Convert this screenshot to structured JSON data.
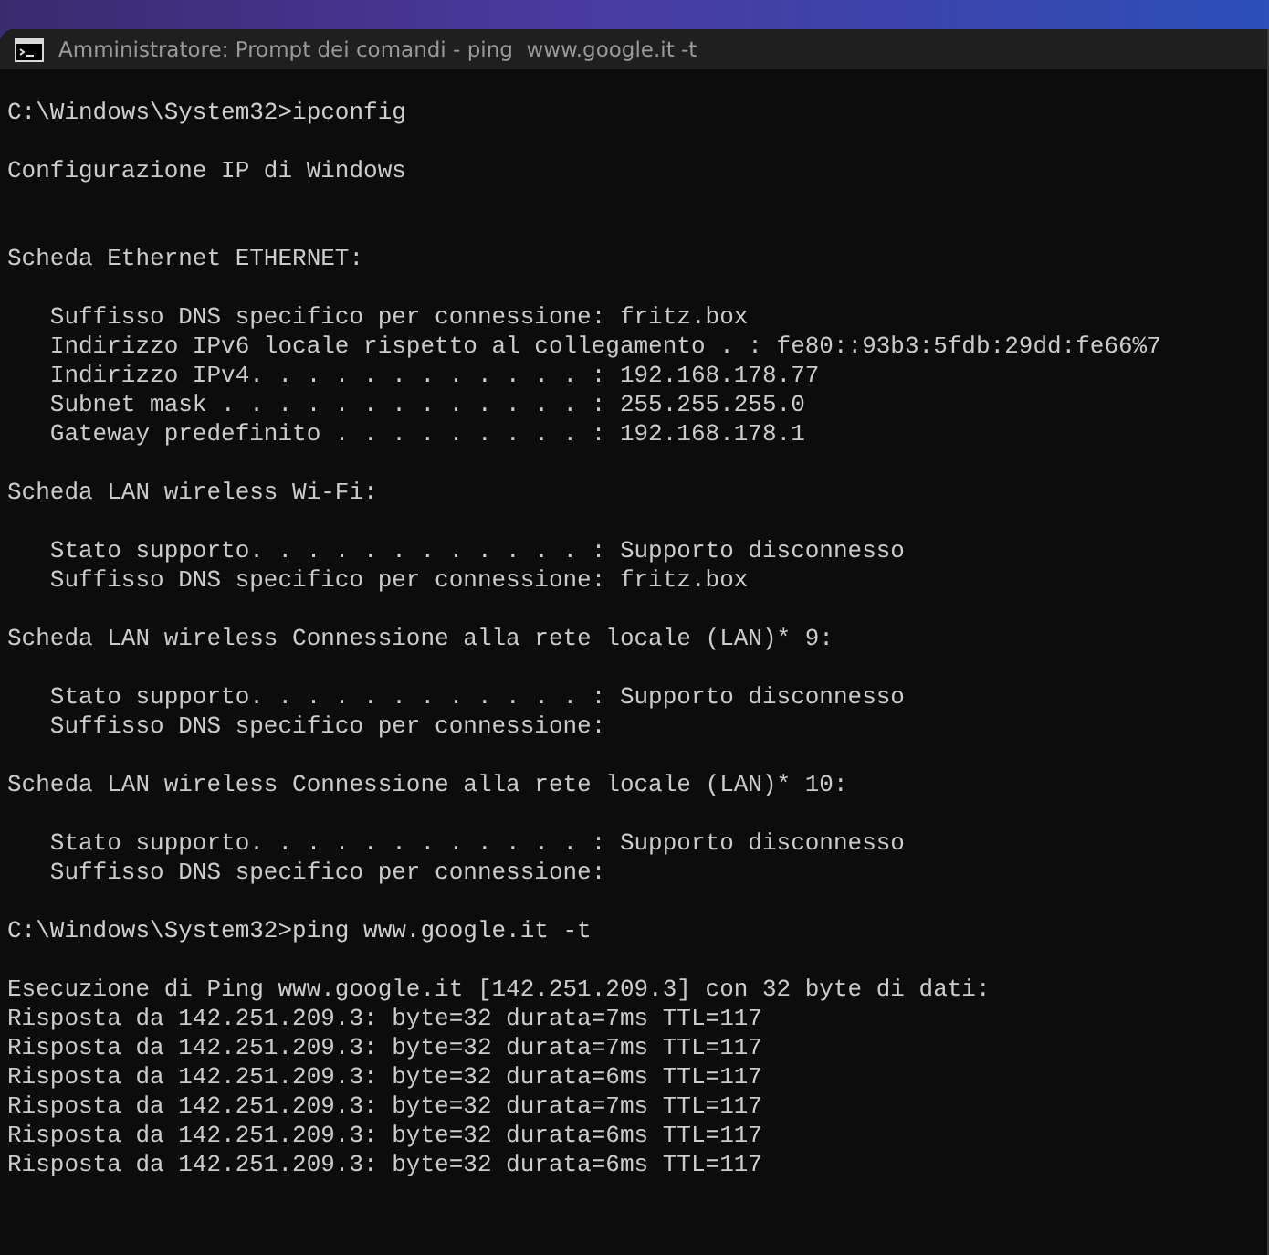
{
  "window": {
    "title": "Amministratore: Prompt dei comandi - ping  www.google.it -t"
  },
  "console": {
    "lines": [
      {
        "kind": "blank"
      },
      {
        "kind": "command",
        "text": "C:\\Windows\\System32>ipconfig"
      },
      {
        "kind": "blank"
      },
      {
        "kind": "output",
        "text": "Configurazione IP di Windows"
      },
      {
        "kind": "blank"
      },
      {
        "kind": "blank"
      },
      {
        "kind": "output",
        "text": "Scheda Ethernet ETHERNET:"
      },
      {
        "kind": "blank"
      },
      {
        "kind": "output",
        "text": "   Suffisso DNS specifico per connessione: fritz.box"
      },
      {
        "kind": "output",
        "text": "   Indirizzo IPv6 locale rispetto al collegamento . : fe80::93b3:5fdb:29dd:fe66%7"
      },
      {
        "kind": "output",
        "text": "   Indirizzo IPv4. . . . . . . . . . . . : 192.168.178.77"
      },
      {
        "kind": "output",
        "text": "   Subnet mask . . . . . . . . . . . . . : 255.255.255.0"
      },
      {
        "kind": "output",
        "text": "   Gateway predefinito . . . . . . . . . : 192.168.178.1"
      },
      {
        "kind": "blank"
      },
      {
        "kind": "output",
        "text": "Scheda LAN wireless Wi-Fi:"
      },
      {
        "kind": "blank"
      },
      {
        "kind": "output",
        "text": "   Stato supporto. . . . . . . . . . . . : Supporto disconnesso"
      },
      {
        "kind": "output",
        "text": "   Suffisso DNS specifico per connessione: fritz.box"
      },
      {
        "kind": "blank"
      },
      {
        "kind": "output",
        "text": "Scheda LAN wireless Connessione alla rete locale (LAN)* 9:"
      },
      {
        "kind": "blank"
      },
      {
        "kind": "output",
        "text": "   Stato supporto. . . . . . . . . . . . : Supporto disconnesso"
      },
      {
        "kind": "output",
        "text": "   Suffisso DNS specifico per connessione:"
      },
      {
        "kind": "blank"
      },
      {
        "kind": "output",
        "text": "Scheda LAN wireless Connessione alla rete locale (LAN)* 10:"
      },
      {
        "kind": "blank"
      },
      {
        "kind": "output",
        "text": "   Stato supporto. . . . . . . . . . . . : Supporto disconnesso"
      },
      {
        "kind": "output",
        "text": "   Suffisso DNS specifico per connessione:"
      },
      {
        "kind": "blank"
      },
      {
        "kind": "command",
        "text": "C:\\Windows\\System32>ping www.google.it -t"
      },
      {
        "kind": "blank"
      },
      {
        "kind": "output",
        "text": "Esecuzione di Ping www.google.it [142.251.209.3] con 32 byte di dati:"
      },
      {
        "kind": "output",
        "text": "Risposta da 142.251.209.3: byte=32 durata=7ms TTL=117"
      },
      {
        "kind": "output",
        "text": "Risposta da 142.251.209.3: byte=32 durata=7ms TTL=117"
      },
      {
        "kind": "output",
        "text": "Risposta da 142.251.209.3: byte=32 durata=6ms TTL=117"
      },
      {
        "kind": "output",
        "text": "Risposta da 142.251.209.3: byte=32 durata=7ms TTL=117"
      },
      {
        "kind": "output",
        "text": "Risposta da 142.251.209.3: byte=32 durata=6ms TTL=117"
      },
      {
        "kind": "output",
        "text": "Risposta da 142.251.209.3: byte=32 durata=6ms TTL=117"
      }
    ]
  }
}
